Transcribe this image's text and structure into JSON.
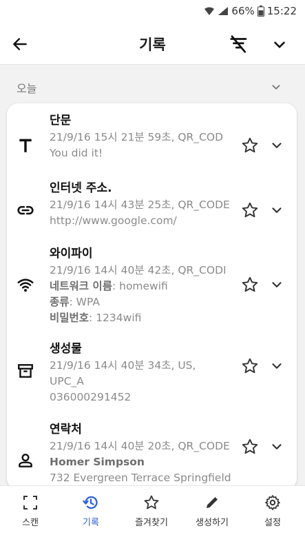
{
  "status": {
    "battery": "66%",
    "time": "15:22"
  },
  "header": {
    "title": "기록"
  },
  "section": {
    "label": "오늘"
  },
  "items": [
    {
      "title": "단문",
      "lines": [
        "21/9/16 15시 21분 59초, QR_COD",
        "You did it!"
      ]
    },
    {
      "title": "인터넷 주소.",
      "lines": [
        "21/9/16 14시 43분 25초, QR_CODE",
        "http://www.google.com/"
      ]
    },
    {
      "title": "와이파이",
      "lines": [
        "21/9/16 14시 40분 42초, QR_CODI"
      ],
      "fields": [
        {
          "k": "네트워크 이름",
          "v": ": homewifi"
        },
        {
          "k": "종류",
          "v": ": WPA"
        },
        {
          "k": "비밀번호",
          "v": ": 1234wifi"
        }
      ]
    },
    {
      "title": "생성물",
      "lines": [
        "21/9/16 14시 40분 34초, US,",
        "UPC_A",
        "036000291452"
      ]
    },
    {
      "title": "연락처",
      "lines": [
        "21/9/16 14시 40분 20초, QR_CODE",
        "Homer Simpson",
        "732 Evergreen Terrace Springfield"
      ]
    }
  ],
  "nav": [
    {
      "label": "스캔"
    },
    {
      "label": "기록"
    },
    {
      "label": "즐겨찾기"
    },
    {
      "label": "생성하기"
    },
    {
      "label": "설정"
    }
  ],
  "colors": {
    "accent": "#2c62d6",
    "icon": "#222222",
    "muted": "#8a8a8a"
  }
}
